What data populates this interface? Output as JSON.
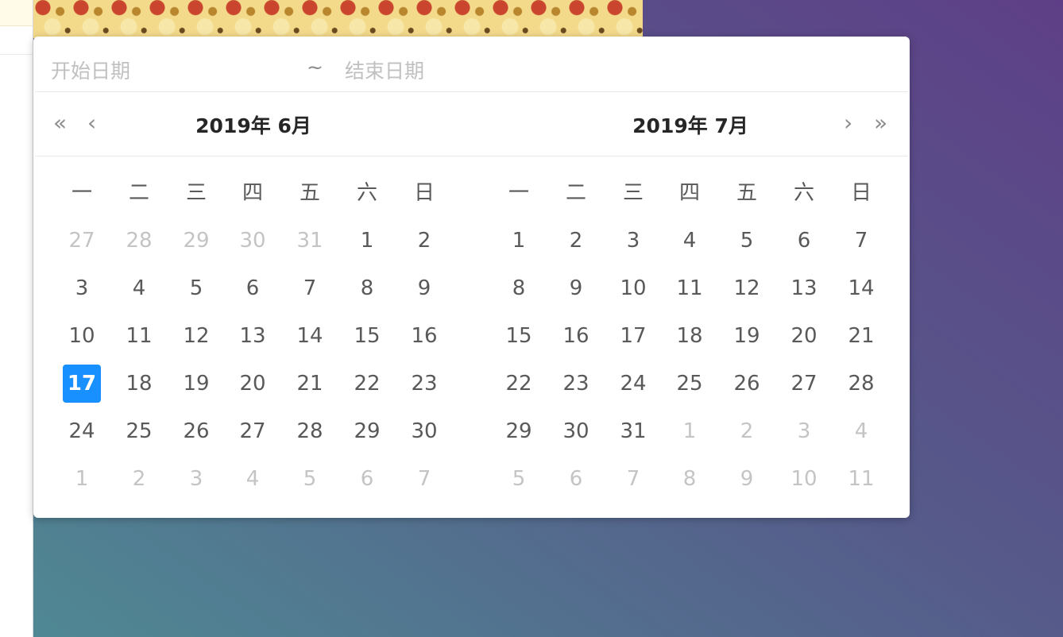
{
  "range_input": {
    "start_placeholder": "开始日期",
    "separator": "~",
    "end_placeholder": "结束日期"
  },
  "nav": {
    "prev_year": "«",
    "prev_month": "‹",
    "next_month": "›",
    "next_year": "»"
  },
  "colors": {
    "selected_bg": "#1890ff",
    "muted_text": "#c4c4c4"
  },
  "calendars": [
    {
      "title": "2019年 6月",
      "weekdays": [
        "一",
        "二",
        "三",
        "四",
        "五",
        "六",
        "日"
      ],
      "selected": "17",
      "rows": [
        [
          [
            "27",
            "prev"
          ],
          [
            "28",
            "prev"
          ],
          [
            "29",
            "prev"
          ],
          [
            "30",
            "prev"
          ],
          [
            "31",
            "prev"
          ],
          [
            "1",
            "cur"
          ],
          [
            "2",
            "cur"
          ]
        ],
        [
          [
            "3",
            "cur"
          ],
          [
            "4",
            "cur"
          ],
          [
            "5",
            "cur"
          ],
          [
            "6",
            "cur"
          ],
          [
            "7",
            "cur"
          ],
          [
            "8",
            "cur"
          ],
          [
            "9",
            "cur"
          ]
        ],
        [
          [
            "10",
            "cur"
          ],
          [
            "11",
            "cur"
          ],
          [
            "12",
            "cur"
          ],
          [
            "13",
            "cur"
          ],
          [
            "14",
            "cur"
          ],
          [
            "15",
            "cur"
          ],
          [
            "16",
            "cur"
          ]
        ],
        [
          [
            "17",
            "cur"
          ],
          [
            "18",
            "cur"
          ],
          [
            "19",
            "cur"
          ],
          [
            "20",
            "cur"
          ],
          [
            "21",
            "cur"
          ],
          [
            "22",
            "cur"
          ],
          [
            "23",
            "cur"
          ]
        ],
        [
          [
            "24",
            "cur"
          ],
          [
            "25",
            "cur"
          ],
          [
            "26",
            "cur"
          ],
          [
            "27",
            "cur"
          ],
          [
            "28",
            "cur"
          ],
          [
            "29",
            "cur"
          ],
          [
            "30",
            "cur"
          ]
        ],
        [
          [
            "1",
            "next"
          ],
          [
            "2",
            "next"
          ],
          [
            "3",
            "next"
          ],
          [
            "4",
            "next"
          ],
          [
            "5",
            "next"
          ],
          [
            "6",
            "next"
          ],
          [
            "7",
            "next"
          ]
        ]
      ]
    },
    {
      "title": "2019年 7月",
      "weekdays": [
        "一",
        "二",
        "三",
        "四",
        "五",
        "六",
        "日"
      ],
      "selected": "",
      "rows": [
        [
          [
            "1",
            "cur"
          ],
          [
            "2",
            "cur"
          ],
          [
            "3",
            "cur"
          ],
          [
            "4",
            "cur"
          ],
          [
            "5",
            "cur"
          ],
          [
            "6",
            "cur"
          ],
          [
            "7",
            "cur"
          ]
        ],
        [
          [
            "8",
            "cur"
          ],
          [
            "9",
            "cur"
          ],
          [
            "10",
            "cur"
          ],
          [
            "11",
            "cur"
          ],
          [
            "12",
            "cur"
          ],
          [
            "13",
            "cur"
          ],
          [
            "14",
            "cur"
          ]
        ],
        [
          [
            "15",
            "cur"
          ],
          [
            "16",
            "cur"
          ],
          [
            "17",
            "cur"
          ],
          [
            "18",
            "cur"
          ],
          [
            "19",
            "cur"
          ],
          [
            "20",
            "cur"
          ],
          [
            "21",
            "cur"
          ]
        ],
        [
          [
            "22",
            "cur"
          ],
          [
            "23",
            "cur"
          ],
          [
            "24",
            "cur"
          ],
          [
            "25",
            "cur"
          ],
          [
            "26",
            "cur"
          ],
          [
            "27",
            "cur"
          ],
          [
            "28",
            "cur"
          ]
        ],
        [
          [
            "29",
            "cur"
          ],
          [
            "30",
            "cur"
          ],
          [
            "31",
            "cur"
          ],
          [
            "1",
            "next"
          ],
          [
            "2",
            "next"
          ],
          [
            "3",
            "next"
          ],
          [
            "4",
            "next"
          ]
        ],
        [
          [
            "5",
            "next"
          ],
          [
            "6",
            "next"
          ],
          [
            "7",
            "next"
          ],
          [
            "8",
            "next"
          ],
          [
            "9",
            "next"
          ],
          [
            "10",
            "next"
          ],
          [
            "11",
            "next"
          ]
        ]
      ]
    }
  ]
}
